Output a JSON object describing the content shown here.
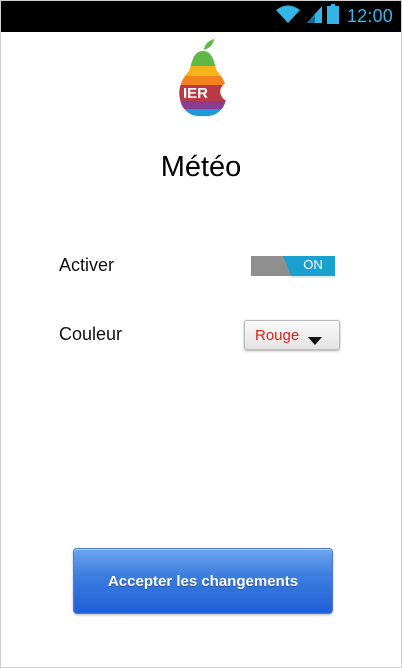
{
  "status_bar": {
    "time": "12:00",
    "icons": [
      "wifi-icon",
      "signal-icon",
      "battery-icon"
    ],
    "accent": "#33b5e5"
  },
  "logo": {
    "text": "IER",
    "name": "pear-logo"
  },
  "page": {
    "title": "Météo"
  },
  "settings": {
    "activate": {
      "label": "Activer",
      "state": "ON",
      "on_color": "#1ba1d0"
    },
    "color": {
      "label": "Couleur",
      "selected": "Rouge",
      "selected_color": "#e0201b"
    }
  },
  "actions": {
    "accept_label": "Accepter les changements",
    "button_color": "#2566d9"
  }
}
